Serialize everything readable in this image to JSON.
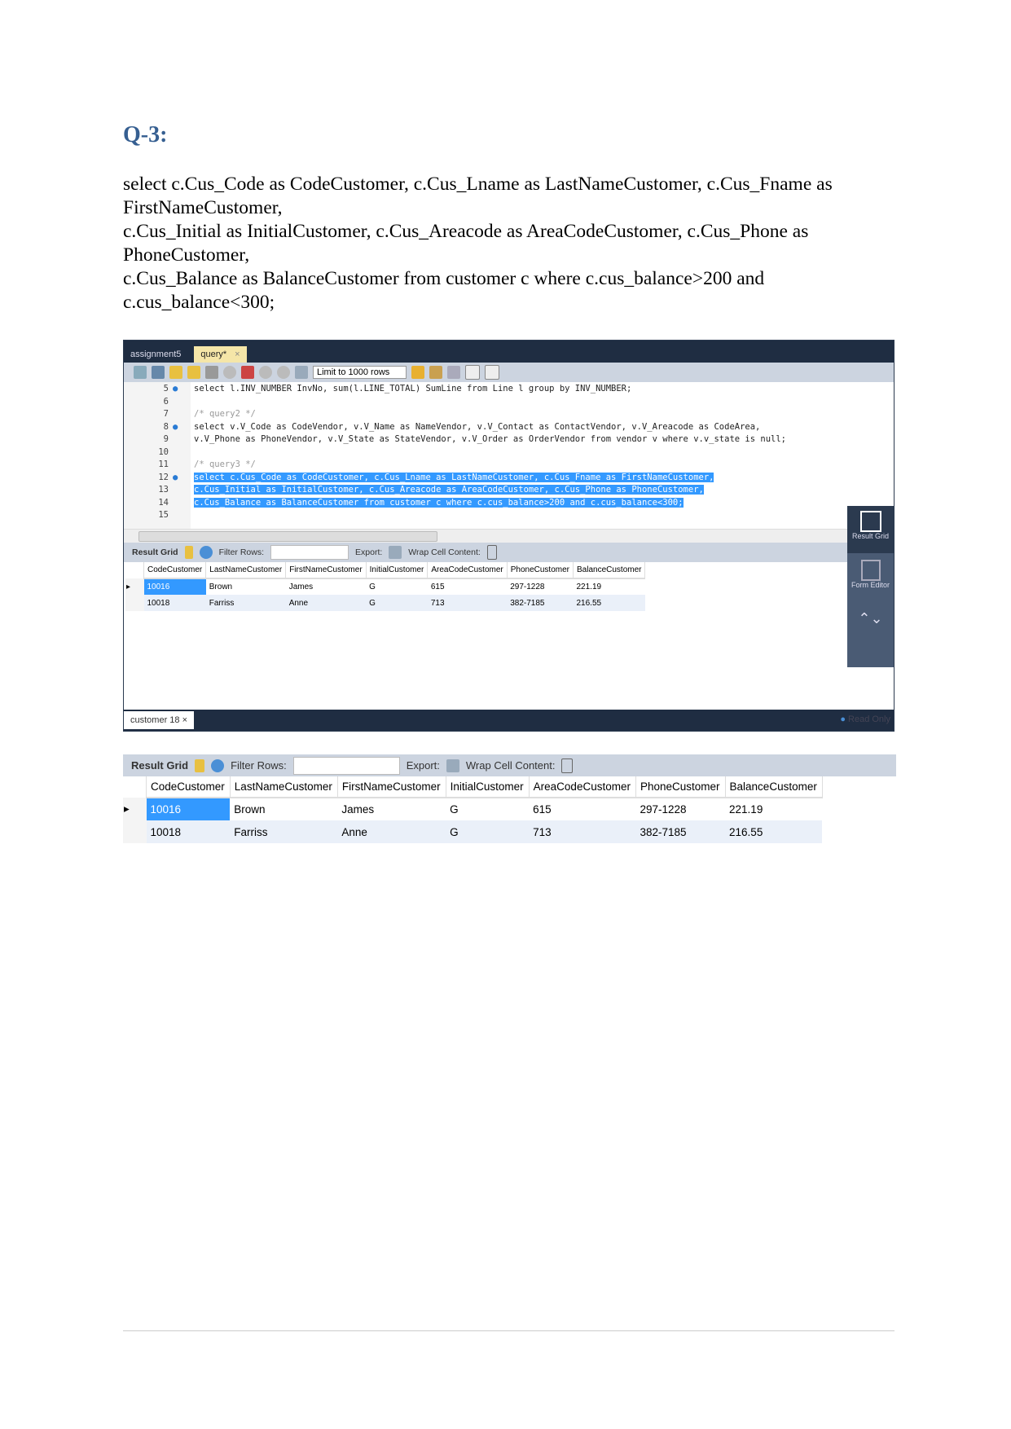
{
  "heading": "Q-3:",
  "query_lines": [
    "select c.Cus_Code as CodeCustomer, c.Cus_Lname as LastNameCustomer, c.Cus_Fname as FirstNameCustomer,",
    "c.Cus_Initial as InitialCustomer, c.Cus_Areacode as AreaCodeCustomer, c.Cus_Phone as PhoneCustomer,",
    "c.Cus_Balance as BalanceCustomer from customer c where c.cus_balance>200 and c.cus_balance<300;"
  ],
  "workbench": {
    "tabs": [
      "assignment5",
      "query*"
    ],
    "limit": "Limit to 1000 rows",
    "lines": [
      {
        "n": "5",
        "dot": true,
        "text": "select l.INV_NUMBER InvNo, sum(l.LINE_TOTAL) SumLine from Line l group by INV_NUMBER;"
      },
      {
        "n": "6",
        "text": ""
      },
      {
        "n": "7",
        "text": "/* query2 */",
        "cm": true
      },
      {
        "n": "8",
        "dot": true,
        "text": "select v.V_Code as CodeVendor, v.V_Name as NameVendor, v.V_Contact as ContactVendor, v.V_Areacode as CodeArea,"
      },
      {
        "n": "9",
        "text": "v.V_Phone as PhoneVendor, v.V_State as StateVendor, v.V_Order as OrderVendor from vendor v where v.v_state is null;"
      },
      {
        "n": "10",
        "text": ""
      },
      {
        "n": "11",
        "text": "/* query3 */",
        "cm": true
      },
      {
        "n": "12",
        "dot": true,
        "hl": true,
        "text": "select c.Cus_Code as CodeCustomer, c.Cus_Lname as LastNameCustomer, c.Cus_Fname as FirstNameCustomer,"
      },
      {
        "n": "13",
        "hl": true,
        "text": "c.Cus_Initial as InitialCustomer, c.Cus_Areacode as AreaCodeCustomer, c.Cus_Phone as PhoneCustomer,"
      },
      {
        "n": "14",
        "hl": true,
        "text": "c.Cus_Balance as BalanceCustomer from customer c where c.cus_balance>200 and c.cus_balance<300;"
      },
      {
        "n": "15",
        "text": ""
      }
    ],
    "side": {
      "result_grid": "Result Grid",
      "form_editor": "Form Editor"
    },
    "bottom_tab": "customer 18",
    "read_only": "Read Only"
  },
  "result_toolbar": {
    "result_grid": "Result Grid",
    "filter_rows": "Filter Rows:",
    "export": "Export:",
    "wrap": "Wrap Cell Content:"
  },
  "table": {
    "columns": [
      "CodeCustomer",
      "LastNameCustomer",
      "FirstNameCustomer",
      "InitialCustomer",
      "AreaCodeCustomer",
      "PhoneCustomer",
      "BalanceCustomer"
    ],
    "rows": [
      [
        "10016",
        "Brown",
        "James",
        "G",
        "615",
        "297-1228",
        "221.19"
      ],
      [
        "10018",
        "Farriss",
        "Anne",
        "G",
        "713",
        "382-7185",
        "216.55"
      ]
    ]
  }
}
